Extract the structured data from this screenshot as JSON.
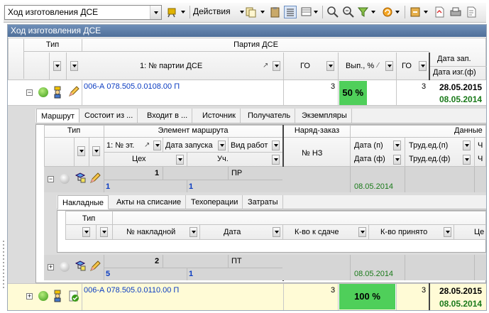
{
  "toolbar": {
    "view_select": "Ход изготовления ДСЕ",
    "actions_label": "Действия"
  },
  "panel": {
    "title": "Ход изготовления ДСЕ"
  },
  "grid": {
    "col_type": "Тип",
    "col_party_group": "Партия ДСЕ",
    "col_party_no": "1: № партии ДСЕ",
    "col_go": "ГО",
    "col_done": "Вып., %",
    "col_go2": "ГО",
    "col_date_start": "Дата зап.",
    "col_date_made": "Дата изг.(ф)",
    "rows": [
      {
        "party": "006-А 078.505.0.0108.00 П",
        "go": "3",
        "done": "50 %",
        "done_pct": 50,
        "go2": "3",
        "date_start": "28.05.2015",
        "date_made": "08.05.2014",
        "expander": "−"
      },
      {
        "party": "006-А 078.505.0.0110.00 П",
        "go": "3",
        "done": "100 %",
        "done_pct": 100,
        "go2": "3",
        "date_start": "28.05.2015",
        "date_made": "08.05.2014",
        "expander": "+"
      }
    ]
  },
  "detail_tabs": [
    "Маршрут",
    "Состоит из ...",
    "Входит в ...",
    "Источник",
    "Получатель",
    "Экземпляры"
  ],
  "route": {
    "col_type": "Тип",
    "col_element": "Элемент маршрута",
    "col_stage": "1: № эт.",
    "col_start": "Дата запуска",
    "col_worktype": "Вид работ",
    "col_shop": "Цех",
    "col_section": "Уч.",
    "col_order_group": "Наряд-заказ",
    "col_nz": "№ НЗ",
    "col_data_group": "Данные",
    "col_date_p": "Дата (п)",
    "col_date_f": "Дата (ф)",
    "col_labor_p": "Труд.ед.(п)",
    "col_labor_f": "Труд.ед.(ф)",
    "col_extra": "Ч",
    "rows": [
      {
        "stage": "1",
        "worktype": "ПР",
        "shop": "1",
        "section": "1",
        "date_f": "08.05.2014",
        "expander": "−"
      },
      {
        "stage": "2",
        "worktype": "ПТ",
        "shop": "5",
        "section": "1",
        "date_f": "08.05.2014",
        "expander": "+"
      }
    ]
  },
  "sub_tabs": [
    "Накладные",
    "Акты на списание",
    "Техоперации",
    "Затраты"
  ],
  "invoices": {
    "col_type": "Тип",
    "col_no": "№ накладной",
    "col_date": "Дата",
    "col_qty_give": "К-во к сдаче",
    "col_qty_taken": "К-во принято",
    "col_price": "Це"
  },
  "colors": {
    "title_bar": "#4f6f99",
    "progress": "#4fcf5a",
    "link": "#0b3cc1",
    "date_green": "#1a7a1a",
    "highlight_row": "#fffbd6"
  }
}
